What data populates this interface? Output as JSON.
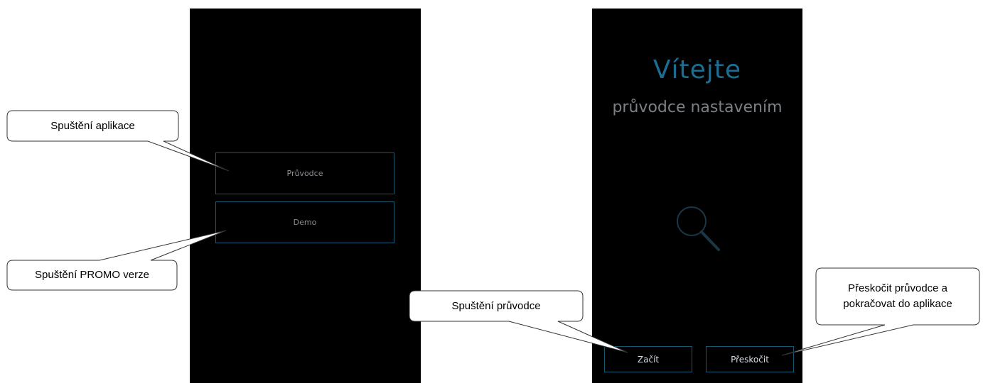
{
  "left_screen": {
    "guide_button": "Průvodce",
    "demo_button": "Demo"
  },
  "right_screen": {
    "title": "Vítejte",
    "subtitle": "průvodce nastavením",
    "illustration_icon": "magnifier-icon",
    "start_button": "Začít",
    "skip_button": "Přeskočit"
  },
  "callouts": {
    "launch": "Spuštění aplikace",
    "promo": "Spuštění PROMO verze",
    "guide": "Spuštění průvodce",
    "skip_line1": "Přeskočit průvodce a",
    "skip_line2": "pokračovat do aplikace"
  },
  "colors": {
    "screen_bg": "#000000",
    "button_border": "#17566f",
    "title_accent": "#1c6d94"
  }
}
